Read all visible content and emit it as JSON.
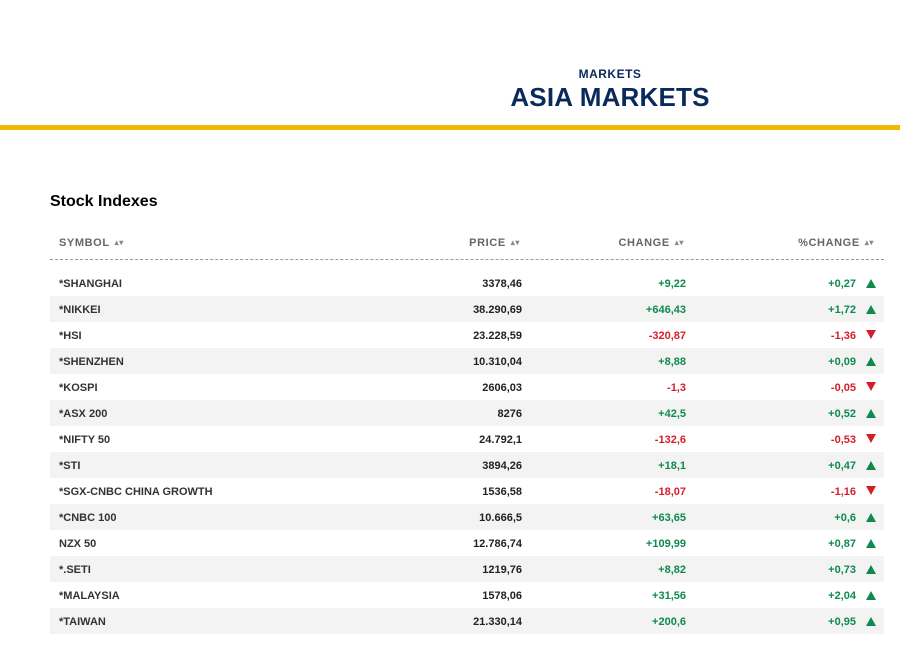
{
  "header": {
    "kicker": "MARKETS",
    "title": "ASIA MARKETS",
    "accent_color": "#f5b800",
    "title_color": "#0b2a5c"
  },
  "section": {
    "title": "Stock Indexes"
  },
  "table": {
    "columns": {
      "symbol": "SYMBOL",
      "price": "PRICE",
      "change": "CHANGE",
      "pct_change": "%CHANGE",
      "sort_icon": "sort-arrows-icon"
    },
    "colors": {
      "up": "#0e8a4f",
      "down": "#d41f2b"
    },
    "rows": [
      {
        "symbol": "*SHANGHAI",
        "price": "3378,46",
        "change": "+9,22",
        "pct": "+0,27",
        "dir": "up"
      },
      {
        "symbol": "*NIKKEI",
        "price": "38.290,69",
        "change": "+646,43",
        "pct": "+1,72",
        "dir": "up"
      },
      {
        "symbol": "*HSI",
        "price": "23.228,59",
        "change": "-320,87",
        "pct": "-1,36",
        "dir": "down"
      },
      {
        "symbol": "*SHENZHEN",
        "price": "10.310,04",
        "change": "+8,88",
        "pct": "+0,09",
        "dir": "up"
      },
      {
        "symbol": "*KOSPI",
        "price": "2606,03",
        "change": "-1,3",
        "pct": "-0,05",
        "dir": "down"
      },
      {
        "symbol": "*ASX 200",
        "price": "8276",
        "change": "+42,5",
        "pct": "+0,52",
        "dir": "up"
      },
      {
        "symbol": "*NIFTY 50",
        "price": "24.792,1",
        "change": "-132,6",
        "pct": "-0,53",
        "dir": "down"
      },
      {
        "symbol": "*STI",
        "price": "3894,26",
        "change": "+18,1",
        "pct": "+0,47",
        "dir": "up"
      },
      {
        "symbol": "*SGX-CNBC CHINA GROWTH",
        "price": "1536,58",
        "change": "-18,07",
        "pct": "-1,16",
        "dir": "down"
      },
      {
        "symbol": "*CNBC 100",
        "price": "10.666,5",
        "change": "+63,65",
        "pct": "+0,6",
        "dir": "up"
      },
      {
        "symbol": "NZX 50",
        "price": "12.786,74",
        "change": "+109,99",
        "pct": "+0,87",
        "dir": "up"
      },
      {
        "symbol": "*.SETI",
        "price": "1219,76",
        "change": "+8,82",
        "pct": "+0,73",
        "dir": "up"
      },
      {
        "symbol": "*MALAYSIA",
        "price": "1578,06",
        "change": "+31,56",
        "pct": "+2,04",
        "dir": "up"
      },
      {
        "symbol": "*TAIWAN",
        "price": "21.330,14",
        "change": "+200,6",
        "pct": "+0,95",
        "dir": "up"
      }
    ]
  }
}
